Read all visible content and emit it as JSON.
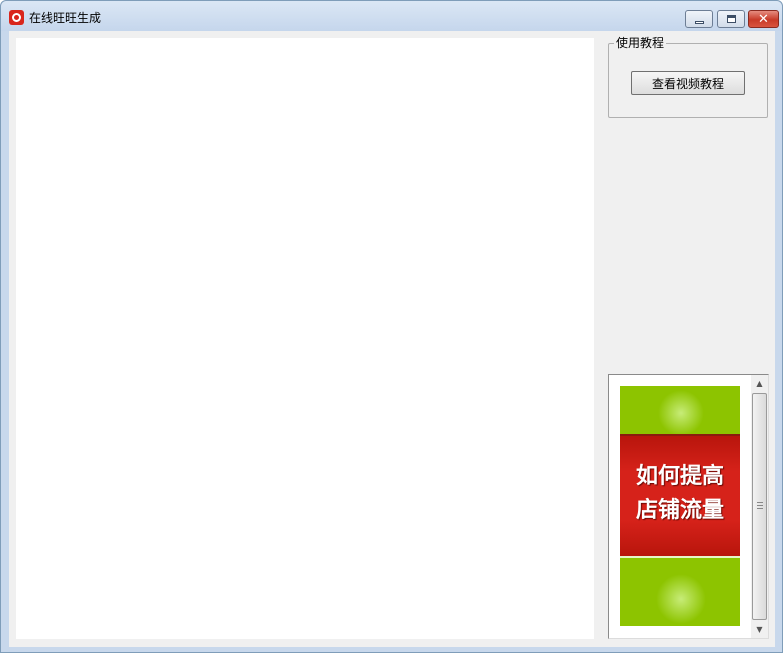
{
  "window": {
    "title": "在线旺旺生成",
    "minimize_icon": "minimize-icon",
    "maximize_icon": "maximize-icon",
    "close_glyph": "✕"
  },
  "sidebar": {
    "group_title": "使用教程",
    "tutorial_button_label": "查看视频教程"
  },
  "ad": {
    "line1": "如何提高",
    "line2": "店铺流量"
  },
  "scrollbar": {
    "up_glyph": "▲",
    "down_glyph": "▼"
  },
  "colors": {
    "app_icon": "#d9261c",
    "ad_green": "#8dc400",
    "ad_red": "#d6221a"
  }
}
